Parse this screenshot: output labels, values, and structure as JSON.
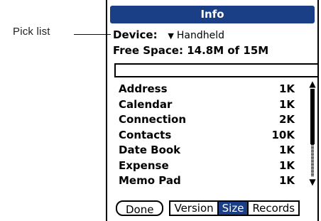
{
  "annotation": {
    "label": "Pick list"
  },
  "window": {
    "title": "Info"
  },
  "device": {
    "label": "Device:",
    "value": "Handheld",
    "arrow": "▼"
  },
  "free_space": "Free Space: 14.8M of 15M",
  "search": {
    "value": ""
  },
  "apps": [
    {
      "name": "Address",
      "size": "1K"
    },
    {
      "name": "Calendar",
      "size": "1K"
    },
    {
      "name": "Connection",
      "size": "2K"
    },
    {
      "name": "Contacts",
      "size": "10K"
    },
    {
      "name": "Date Book",
      "size": "1K"
    },
    {
      "name": "Expense",
      "size": "1K"
    },
    {
      "name": "Memo Pad",
      "size": "1K"
    }
  ],
  "scrollbar": {
    "up_arrow": "▲",
    "down_arrow": "▼"
  },
  "buttons": {
    "done": "Done",
    "tabs": [
      "Version",
      "Size",
      "Records"
    ],
    "selected_tab": "Size"
  },
  "colors": {
    "accent": "#1b3f86",
    "background": "#ffffff",
    "text": "#000000"
  },
  "icons": [
    "dropdown-triangle-icon",
    "scroll-up-arrow-icon",
    "scroll-down-arrow-icon"
  ]
}
